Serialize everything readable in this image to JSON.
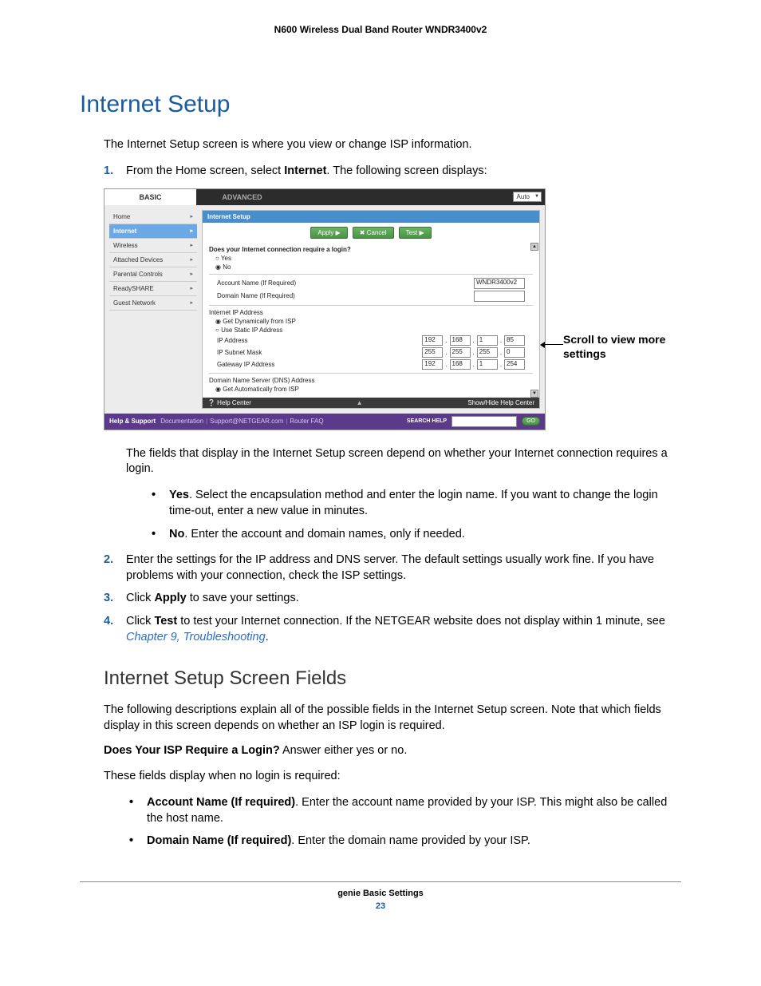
{
  "doc": {
    "header": "N600 Wireless Dual Band Router WNDR3400v2",
    "h1": "Internet Setup",
    "intro": "The Internet Setup screen is where you view or change ISP information.",
    "step1_a": "From the Home screen, select ",
    "step1_b": "Internet",
    "step1_c": ". The following screen displays:",
    "callout": "Scroll to view more settings",
    "after_fig": "The fields that display in the Internet Setup screen depend on whether your Internet connection requires a login.",
    "yn_yes_b": "Yes",
    "yn_yes": ". Select the encapsulation method and enter the login name. If you want to change the login time-out, enter a new value in minutes.",
    "yn_no_b": "No",
    "yn_no": ". Enter the account and domain names, only if needed.",
    "step2": "Enter the settings for the IP address and DNS server. The default settings usually work fine. If you have problems with your connection, check the ISP settings.",
    "step3_a": "Click ",
    "step3_b": "Apply",
    "step3_c": " to save your settings.",
    "step4_a": "Click ",
    "step4_b": "Test",
    "step4_c": " to test your Internet connection. If the NETGEAR website does not display within 1 minute, see ",
    "step4_link": "Chapter 9, Troubleshooting",
    "step4_d": ".",
    "h2": "Internet Setup Screen Fields",
    "p2a": "The following descriptions explain all of the possible fields in the Internet Setup screen. Note that which fields display in this screen depends on whether an ISP login is required.",
    "p2b_b": "Does Your ISP Require a Login?",
    "p2b": " Answer either yes or no.",
    "p2c": "These fields display when no login is required:",
    "acct_b": "Account Name (If required)",
    "acct": ". Enter the account name provided by your ISP. This might also be called the host name.",
    "dom_b": "Domain Name (If required)",
    "dom": ". Enter the domain name provided by your ISP.",
    "footer_title": "genie Basic Settings",
    "pageno": "23"
  },
  "ui": {
    "tab_basic": "BASIC",
    "tab_advanced": "ADVANCED",
    "auto": "Auto",
    "side": [
      "Home",
      "Internet",
      "Wireless",
      "Attached Devices",
      "Parental Controls",
      "ReadySHARE",
      "Guest Network"
    ],
    "title": "Internet Setup",
    "btn_apply": "Apply ▶",
    "btn_cancel": "✖ Cancel",
    "btn_test": "Test ▶",
    "q_login": "Does your Internet connection require a login?",
    "yes": "Yes",
    "no": "No",
    "account_name": "Account Name  (If Required)",
    "domain_name": "Domain Name  (If Required)",
    "account_value": "WNDR3400v2",
    "ip_header": "Internet IP Address",
    "ip_dyn": "Get Dynamically from ISP",
    "ip_static": "Use Static IP Address",
    "ip_addr": "IP Address",
    "ip_subnet": "IP Subnet Mask",
    "ip_gateway": "Gateway IP Address",
    "ip1": [
      "192",
      "168",
      "1",
      "85"
    ],
    "ip2": [
      "255",
      "255",
      "255",
      "0"
    ],
    "ip3": [
      "192",
      "168",
      "1",
      "254"
    ],
    "dns_header": "Domain Name Server (DNS) Address",
    "dns_auto": "Get Automatically from ISP",
    "help_center": "❔ Help Center",
    "show_hide": "Show/Hide Help Center",
    "hs_label": "Help & Support",
    "hs_doc": "Documentation",
    "hs_sup": "Support@NETGEAR.com",
    "hs_faq": "Router FAQ",
    "search_label": "SEARCH HELP",
    "go": "GO"
  }
}
